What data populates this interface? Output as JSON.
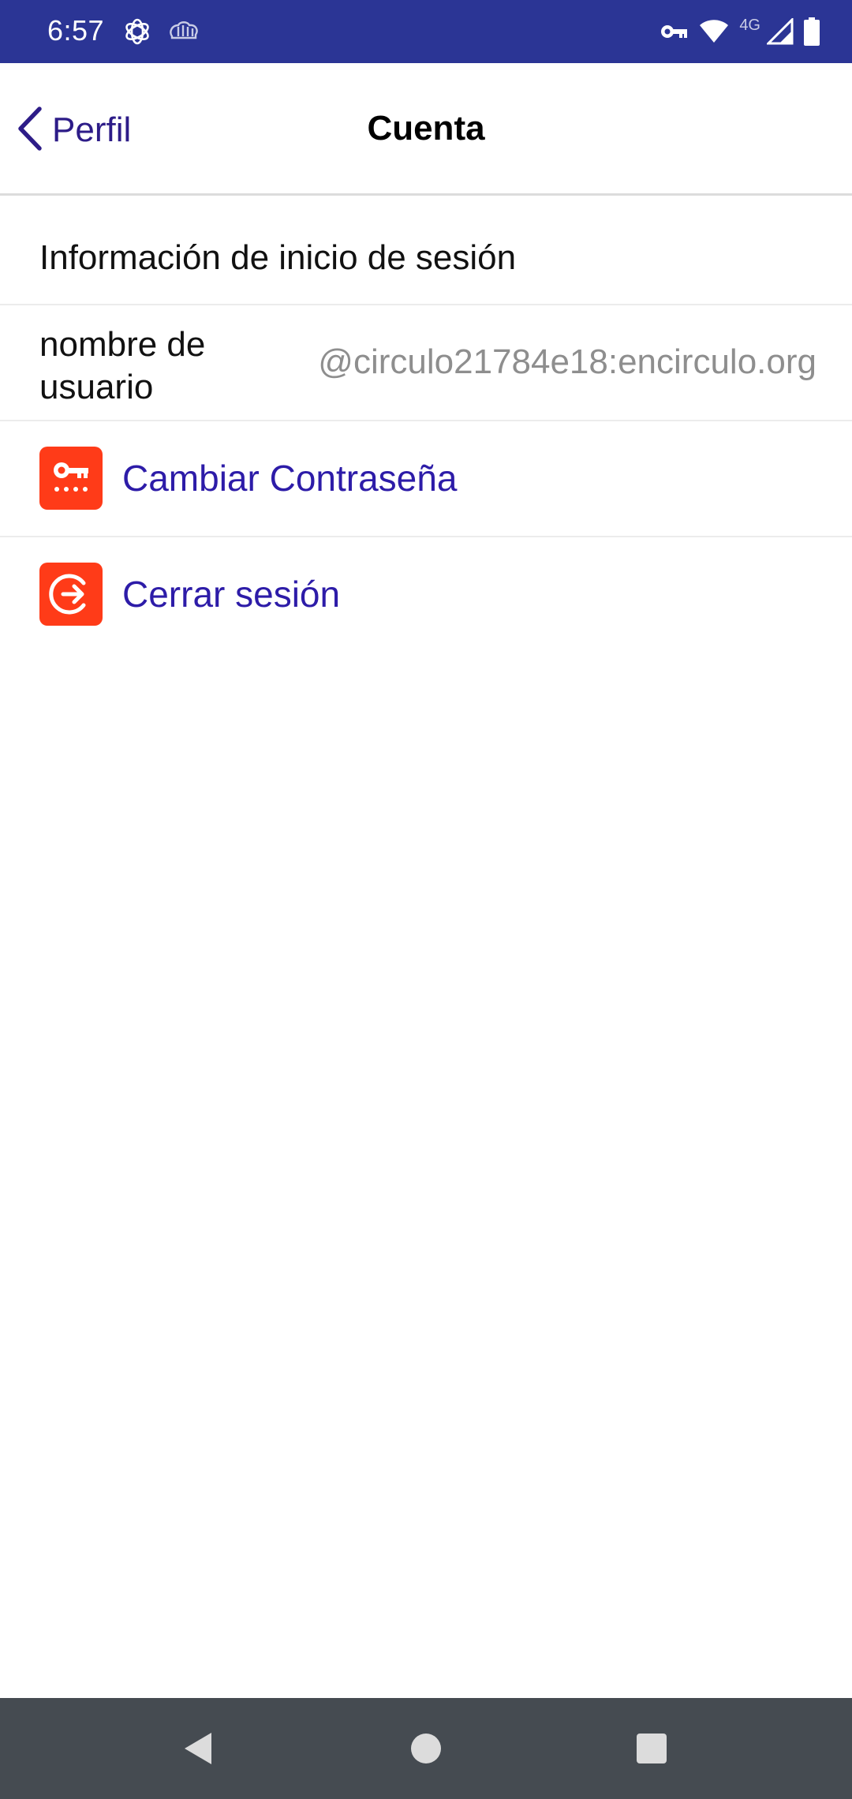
{
  "status_bar": {
    "time": "6:57",
    "left_icons": [
      "openai-icon",
      "brain-icon"
    ],
    "right_icons": [
      "vpn-key-icon",
      "wifi-icon",
      "cell-signal-icon",
      "battery-icon"
    ],
    "network_type": "4G",
    "background": "#2b3595"
  },
  "header": {
    "back_label": "Perfil",
    "title": "Cuenta"
  },
  "section": {
    "title": "Información de inicio de sesión"
  },
  "username_row": {
    "label": "nombre de usuario",
    "value": "@circulo21784e18:encirculo.org"
  },
  "actions": [
    {
      "label": "Cambiar Contraseña",
      "icon": "key-password-icon"
    },
    {
      "label": "Cerrar sesión",
      "icon": "logout-icon"
    }
  ],
  "colors": {
    "accent": "#2d1ca8",
    "icon_bg": "#ff3b18",
    "nav_bar": "#454b51"
  },
  "nav_bar": {
    "buttons": [
      "back-triangle-icon",
      "home-circle-icon",
      "recents-square-icon"
    ]
  }
}
